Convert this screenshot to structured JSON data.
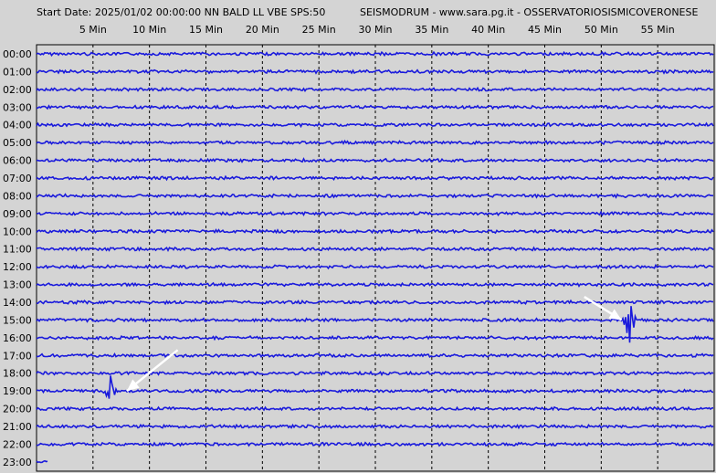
{
  "header": {
    "station_info": "Start Date: 2025/01/02 00:00:00 NN BALD LL VBE SPS:50",
    "source_info": "SEISMODRUM - www.sara.pg.it - OSSERVATORIOSISMICOVERONESE"
  },
  "colors": {
    "background": "#d4d4d4",
    "trace": "#1a1adc",
    "grid": "#000000",
    "arrow": "#ffffff"
  },
  "chart_data": {
    "type": "line",
    "title": "",
    "xlabel": "",
    "ylabel": "",
    "x_ticks": [
      "5 Min",
      "10 Min",
      "15 Min",
      "20 Min",
      "25 Min",
      "30 Min",
      "35 Min",
      "40 Min",
      "45 Min",
      "50 Min",
      "55 Min"
    ],
    "x_tick_minutes": [
      5,
      10,
      15,
      20,
      25,
      30,
      35,
      40,
      45,
      50,
      55
    ],
    "xlim_minutes": [
      0,
      60
    ],
    "grid": true,
    "rows": [
      "00:00",
      "01:00",
      "02:00",
      "03:00",
      "04:00",
      "05:00",
      "06:00",
      "07:00",
      "08:00",
      "09:00",
      "10:00",
      "11:00",
      "12:00",
      "13:00",
      "14:00",
      "15:00",
      "16:00",
      "17:00",
      "18:00",
      "19:00",
      "20:00",
      "21:00",
      "22:00",
      "23:00"
    ],
    "partial_last_row_minutes": 1,
    "events": [
      {
        "row": "15:00",
        "minute": 52.5,
        "amplitude": 3.0
      },
      {
        "row": "19:00",
        "minute": 6.5,
        "amplitude": 2.0
      }
    ],
    "annotations": [
      {
        "type": "arrow",
        "from_row": "14:00",
        "from_minute": 48.5,
        "to_row": "15:00",
        "to_minute": 51.8
      },
      {
        "type": "arrow",
        "from_row": "17:00",
        "from_minute": 12.5,
        "to_row": "19:00",
        "to_minute": 8.0
      }
    ]
  }
}
